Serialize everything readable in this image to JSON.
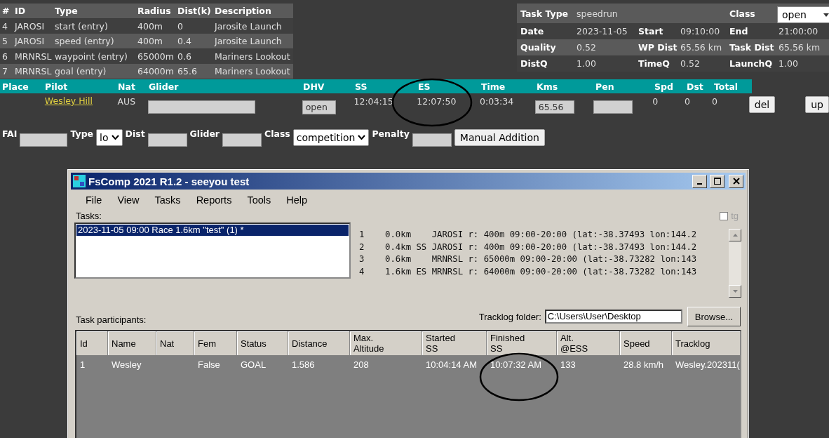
{
  "waypoints": {
    "columns": [
      "#",
      "ID",
      "Type",
      "Radius",
      "Dist(k)",
      "Description"
    ],
    "rows": [
      [
        "4",
        "JAROSI",
        "start (entry)",
        "400m",
        "0",
        "Jarosite Launch"
      ],
      [
        "5",
        "JAROSI",
        "speed (entry)",
        "400m",
        "0.4",
        "Jarosite Launch"
      ],
      [
        "6",
        "MRNRSL",
        "waypoint (entry)",
        "65000m",
        "0.6",
        "Mariners Lookout"
      ],
      [
        "7",
        "MRNRSL",
        "goal (entry)",
        "64000m",
        "65.6",
        "Mariners Lookout"
      ]
    ]
  },
  "task_info": {
    "task_type_label": "Task Type",
    "task_type": "speedrun",
    "class_label": "Class",
    "class_value": "open",
    "rows": [
      [
        {
          "label": "Date",
          "value": "2023-11-05"
        },
        {
          "label": "Start",
          "value": "09:10:00"
        },
        {
          "label": "End",
          "value": "21:00:00"
        }
      ],
      [
        {
          "label": "Quality",
          "value": "0.52"
        },
        {
          "label": "WP Dist",
          "value": "65.56 km"
        },
        {
          "label": "Task Dist",
          "value": "65.56 km"
        }
      ],
      [
        {
          "label": "DistQ",
          "value": "1.00"
        },
        {
          "label": "TimeQ",
          "value": "0.52"
        },
        {
          "label": "LaunchQ",
          "value": "1.00"
        }
      ]
    ]
  },
  "results": {
    "columns": [
      "Place",
      "Pilot",
      "Nat",
      "Glider",
      "DHV",
      "SS",
      "ES",
      "Time",
      "Kms",
      "Pen",
      "Spd",
      "Dst",
      "Total"
    ],
    "row": {
      "pilot": "Wesley Hill",
      "nat": "AUS",
      "dhv": "open",
      "ss": "12:04:15",
      "es": "12:07:50",
      "time": "0:03:34",
      "kms": "65.56",
      "spd": "0",
      "dst": "0",
      "total": "0"
    },
    "buttons": [
      "del",
      "up"
    ]
  },
  "addition_form": [
    {
      "kind": "input",
      "label": "FAI"
    },
    {
      "kind": "select",
      "label": "Type",
      "value": "lo"
    },
    {
      "kind": "input",
      "label": "Dist"
    },
    {
      "kind": "input",
      "label": "Glider"
    },
    {
      "kind": "select",
      "label": "Class",
      "value": "competition"
    },
    {
      "kind": "input",
      "label": "Penalty"
    },
    {
      "kind": "button",
      "label": "Manual Addition"
    }
  ],
  "window": {
    "title": "FsComp 2021 R1.2 - seeyou test",
    "menu": [
      "File",
      "View",
      "Tasks",
      "Reports",
      "Tools",
      "Help"
    ],
    "tasks_label": "Tasks:",
    "tasks": [
      {
        "label": "2023-11-05 09:00 Race 1.6km \"test\" (1) *",
        "selected": true
      }
    ],
    "tg": {
      "label": "tg",
      "checked": false
    },
    "waypoint_lines": [
      "1    0.0km    JAROSI r: 400m 09:00-20:00 (lat:-38.37493 lon:144.2",
      "2    0.4km SS JAROSI r: 400m 09:00-20:00 (lat:-38.37493 lon:144.2",
      "3    0.6km    MRNRSL r: 65000m 09:00-20:00 (lat:-38.73282 lon:143",
      "4    1.6km ES MRNRSL r: 64000m 09:00-20:00 (lat:-38.73282 lon:143"
    ],
    "participants_label": "Task participants:",
    "tracklog_label": "Tracklog folder:",
    "tracklog_folder": "C:\\Users\\User\\Desktop",
    "browse": "Browse...",
    "columns": [
      "Id",
      "Name",
      "Nat",
      "Fem",
      "Status",
      "Distance",
      "Max.\nAltitude",
      "Started\nSS",
      "Finished\nSS",
      "Alt.\n@ESS",
      "Speed",
      "Tracklog"
    ],
    "rows": [
      [
        "1",
        "Wesley",
        "",
        "False",
        "GOAL",
        "1.586",
        "208",
        "10:04:14 AM",
        "10:07:32 AM",
        "133",
        "28.8 km/h",
        "Wesley.202311("
      ]
    ]
  }
}
